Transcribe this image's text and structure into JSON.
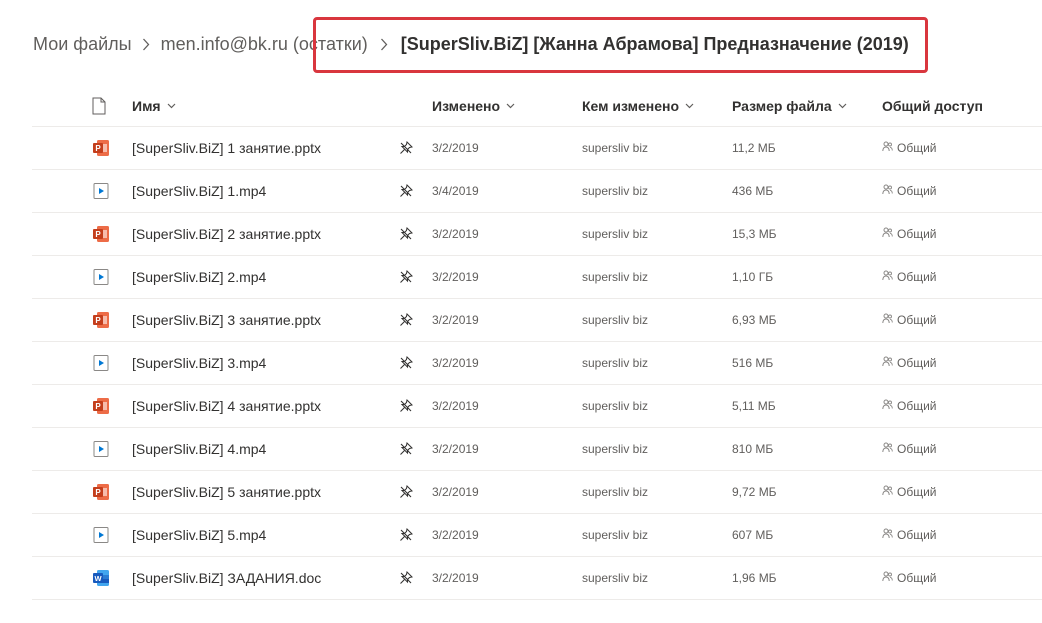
{
  "breadcrumb": {
    "items": [
      "Мои файлы",
      "men.info@bk.ru (остатки)"
    ],
    "current": "[SuperSliv.BiZ] [Жанна Абрамова] Предназначение (2019)"
  },
  "colors": {
    "highlight": "#d9363e",
    "ppt": "#c43e1c",
    "word": "#185abd",
    "video": "#0078d4"
  },
  "columns": {
    "name": "Имя",
    "modified": "Изменено",
    "modified_by": "Кем изменено",
    "size": "Размер файла",
    "sharing": "Общий доступ"
  },
  "files": [
    {
      "name": "[SuperSliv.BiZ] 1 занятие.pptx",
      "type": "pptx",
      "modified": "3/2/2019",
      "modified_by": "supersliv biz",
      "size": "11,2 МБ",
      "sharing": "Общий"
    },
    {
      "name": "[SuperSliv.BiZ] 1.mp4",
      "type": "mp4",
      "modified": "3/4/2019",
      "modified_by": "supersliv biz",
      "size": "436 МБ",
      "sharing": "Общий"
    },
    {
      "name": "[SuperSliv.BiZ] 2 занятие.pptx",
      "type": "pptx",
      "modified": "3/2/2019",
      "modified_by": "supersliv biz",
      "size": "15,3 МБ",
      "sharing": "Общий"
    },
    {
      "name": "[SuperSliv.BiZ] 2.mp4",
      "type": "mp4",
      "modified": "3/2/2019",
      "modified_by": "supersliv biz",
      "size": "1,10 ГБ",
      "sharing": "Общий"
    },
    {
      "name": "[SuperSliv.BiZ] 3 занятие.pptx",
      "type": "pptx",
      "modified": "3/2/2019",
      "modified_by": "supersliv biz",
      "size": "6,93 МБ",
      "sharing": "Общий"
    },
    {
      "name": "[SuperSliv.BiZ] 3.mp4",
      "type": "mp4",
      "modified": "3/2/2019",
      "modified_by": "supersliv biz",
      "size": "516 МБ",
      "sharing": "Общий"
    },
    {
      "name": "[SuperSliv.BiZ] 4 занятие.pptx",
      "type": "pptx",
      "modified": "3/2/2019",
      "modified_by": "supersliv biz",
      "size": "5,11 МБ",
      "sharing": "Общий"
    },
    {
      "name": "[SuperSliv.BiZ] 4.mp4",
      "type": "mp4",
      "modified": "3/2/2019",
      "modified_by": "supersliv biz",
      "size": "810 МБ",
      "sharing": "Общий"
    },
    {
      "name": "[SuperSliv.BiZ] 5 занятие.pptx",
      "type": "pptx",
      "modified": "3/2/2019",
      "modified_by": "supersliv biz",
      "size": "9,72 МБ",
      "sharing": "Общий"
    },
    {
      "name": "[SuperSliv.BiZ] 5.mp4",
      "type": "mp4",
      "modified": "3/2/2019",
      "modified_by": "supersliv biz",
      "size": "607 МБ",
      "sharing": "Общий"
    },
    {
      "name": "[SuperSliv.BiZ] ЗАДАНИЯ.doc",
      "type": "doc",
      "modified": "3/2/2019",
      "modified_by": "supersliv biz",
      "size": "1,96 МБ",
      "sharing": "Общий"
    }
  ]
}
